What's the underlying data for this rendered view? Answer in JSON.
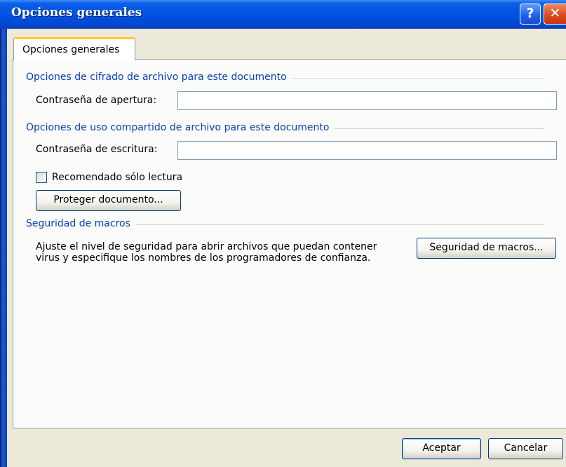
{
  "window": {
    "title": "Opciones generales",
    "help_glyph": "?",
    "close_glyph": "✕"
  },
  "tab": {
    "label": "Opciones generales"
  },
  "encryption": {
    "title": "Opciones de cifrado de archivo para este documento",
    "open_password_label": "Contraseña de apertura:",
    "open_password_value": ""
  },
  "sharing": {
    "title": "Opciones de uso compartido de archivo para este documento",
    "write_password_label": "Contraseña de escritura:",
    "write_password_value": "",
    "readonly_label": "Recomendado sólo lectura",
    "readonly_checked": false,
    "protect_button": "Proteger documento..."
  },
  "macros": {
    "title": "Seguridad de macros",
    "description_line1": "Ajuste el nivel de seguridad para abrir archivos que puedan contener",
    "description_line2": "virus y especifique los nombres de los programadores de confianza.",
    "button": "Seguridad de macros..."
  },
  "footer": {
    "ok": "Aceptar",
    "cancel": "Cancelar"
  }
}
